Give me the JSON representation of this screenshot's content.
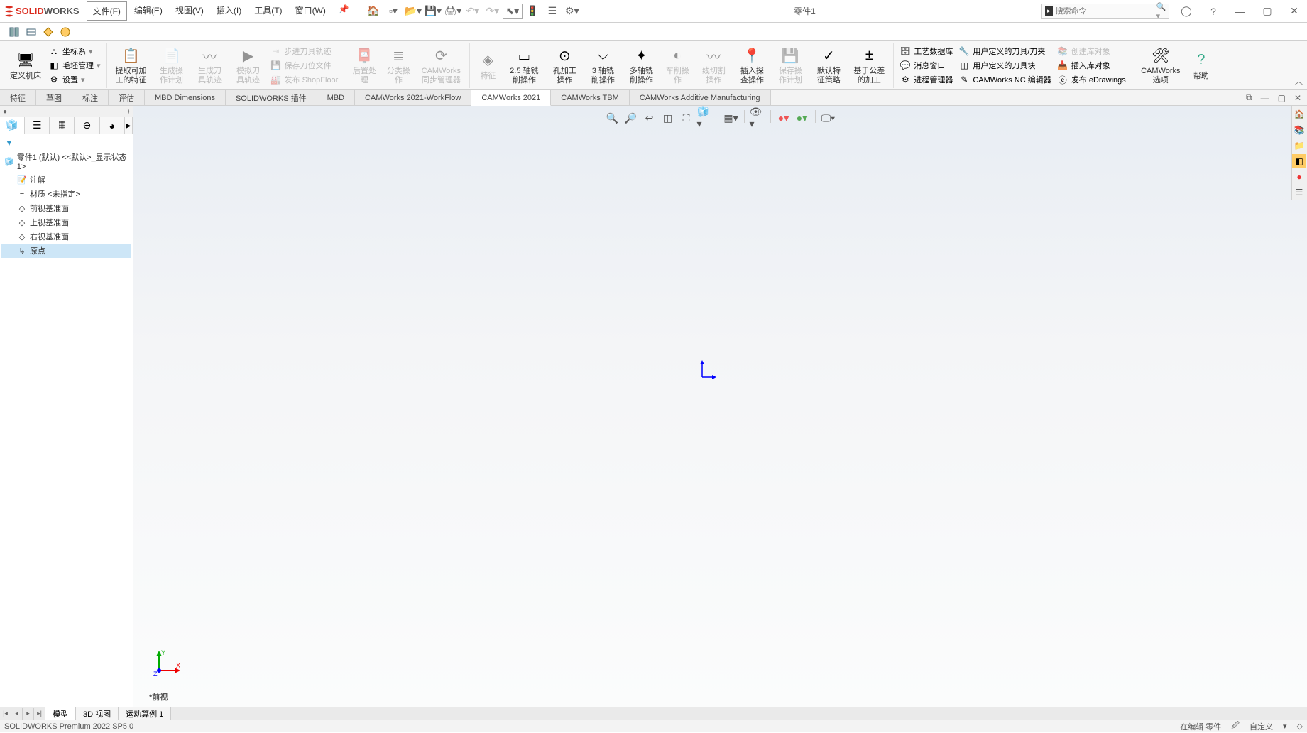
{
  "app": {
    "name_solid": "SOLID",
    "name_works": "WORKS",
    "doc_title": "零件1",
    "search_placeholder": "搜索命令"
  },
  "menubar": [
    "文件(F)",
    "编辑(E)",
    "视图(V)",
    "插入(I)",
    "工具(T)",
    "窗口(W)"
  ],
  "ribbon": {
    "g1": {
      "col1_big": "定义机床",
      "col2": [
        "坐标系",
        "毛坯管理",
        "设置"
      ]
    },
    "g2": {
      "big": "提取可加工的特征",
      "d1": "生成操作计划",
      "d2": "生成刀具轨迹",
      "d3": "模拟刀具轨迹"
    },
    "g2b": {
      "r1": "步进刀具轨迹",
      "r2": "保存刀位文件",
      "r3": "发布 ShopFloor"
    },
    "g3": {
      "d1": "后置处理",
      "d2": "分类操作",
      "d3": "CAMWorks 同步管理器"
    },
    "g4": {
      "b1": "特征",
      "b2": "2.5 轴铣削操作",
      "b3": "孔加工操作",
      "b4": "3 轴铣削操作",
      "b5": "多轴铣削操作",
      "b6": "车削操作",
      "b7": "线切割操作",
      "b8": "插入探查操作",
      "b9": "保存操作计划",
      "b10": "默认特征策略",
      "b11": "基于公差的加工"
    },
    "g5": {
      "r1": "工艺数据库",
      "r2": "消息窗口",
      "r3": "进程管理器",
      "r4": "用户定义的刀具/刀夹",
      "r5": "用户定义的刀具块",
      "r6": "CAMWorks NC 编辑器",
      "r7": "创建库对象",
      "r8": "插入库对象",
      "r9": "发布 eDrawings"
    },
    "g6": {
      "b1": "CAMWorks 选项",
      "b2": "帮助"
    }
  },
  "cmd_tabs": [
    "特征",
    "草图",
    "标注",
    "评估",
    "MBD Dimensions",
    "SOLIDWORKS 插件",
    "MBD",
    "CAMWorks 2021-WorkFlow",
    "CAMWorks 2021",
    "CAMWorks TBM",
    "CAMWorks Additive Manufacturing"
  ],
  "tree": {
    "root": "零件1 (默认) <<默认>_显示状态 1>",
    "items": [
      "注解",
      "材质 <未指定>",
      "前视基准面",
      "上视基准面",
      "右视基准面",
      "原点"
    ]
  },
  "viewport": {
    "label": "*前视"
  },
  "bottom_tabs": [
    "模型",
    "3D 视图",
    "运动算例 1"
  ],
  "status": {
    "left": "SOLIDWORKS Premium 2022 SP5.0",
    "edit": "在编辑 零件",
    "custom": "自定义"
  }
}
